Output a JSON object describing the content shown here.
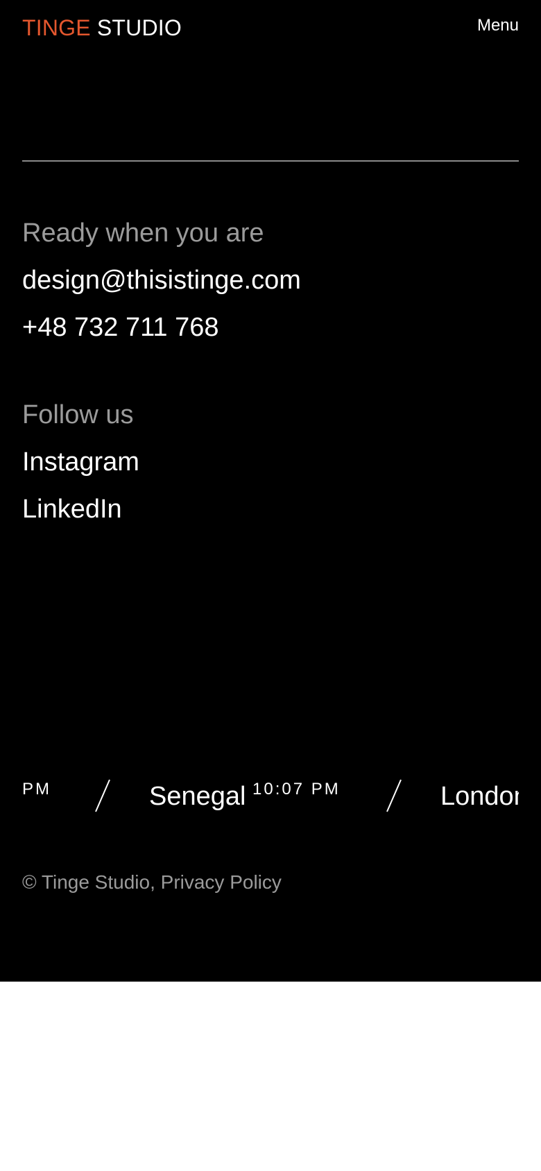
{
  "header": {
    "logo_accent": "TINGE",
    "logo_rest": "STUDIO",
    "menu_label": "Menu"
  },
  "contact": {
    "title": "Ready when you are",
    "email": "design@thisistinge.com",
    "phone": "+48 732 711 768"
  },
  "social": {
    "title": "Follow us",
    "items": [
      {
        "label": "Instagram"
      },
      {
        "label": "LinkedIn"
      }
    ]
  },
  "ticker": {
    "lead_time": "PM",
    "cities": [
      {
        "name": "Senegal",
        "time": "10:07 PM"
      },
      {
        "name": "London"
      }
    ]
  },
  "footer": {
    "copyright": "© Tinge Studio,",
    "privacy": "Privacy Policy"
  },
  "colors": {
    "accent": "#e4572e",
    "background": "#000000",
    "muted_text": "#9b9b9b"
  }
}
